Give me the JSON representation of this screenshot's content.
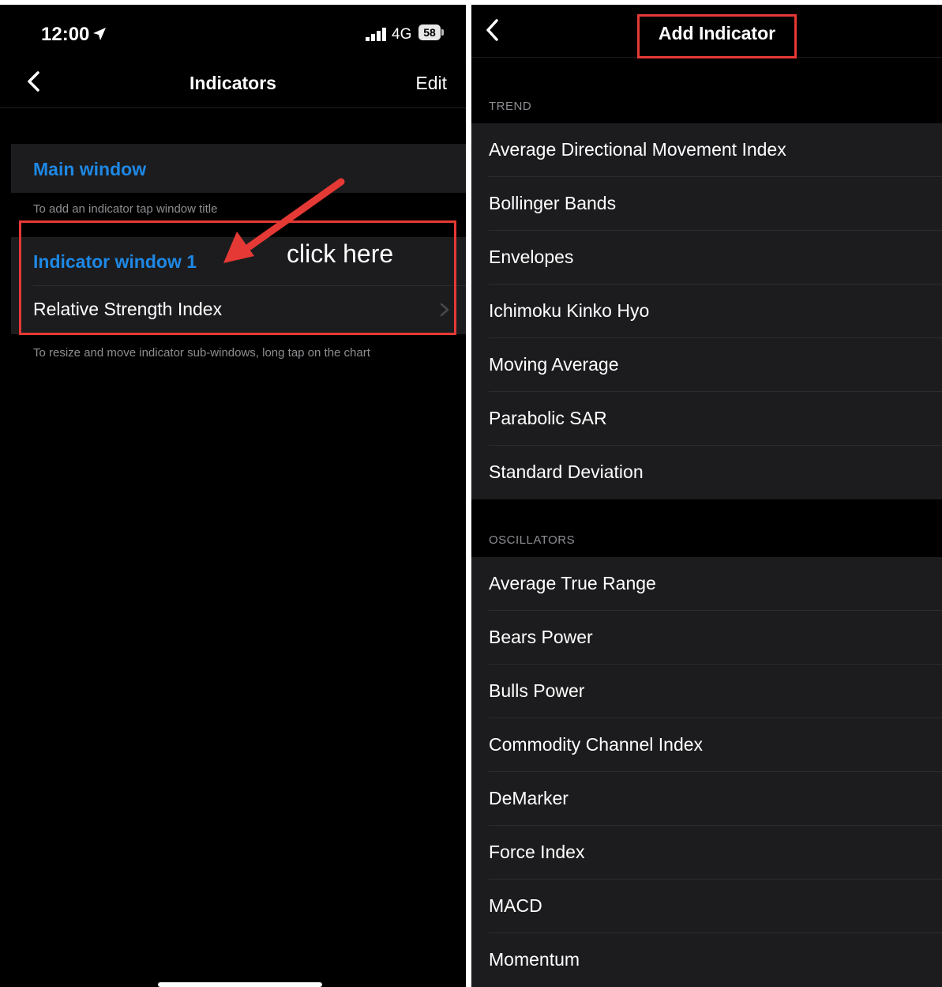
{
  "left": {
    "status": {
      "time": "12:00",
      "network": "4G",
      "battery": "58"
    },
    "nav": {
      "title": "Indicators",
      "edit_label": "Edit"
    },
    "main_window": {
      "title": "Main window"
    },
    "hint": "To add an indicator tap window title",
    "indicator_window": {
      "title": "Indicator window 1",
      "items": [
        "Relative Strength Index"
      ]
    },
    "footer_hint": "To resize and move indicator sub-windows, long tap on the chart",
    "annotation": {
      "text": "click here",
      "color": "#e53935"
    }
  },
  "right": {
    "nav": {
      "title": "Add Indicator"
    },
    "sections": [
      {
        "header": "TREND",
        "items": [
          "Average Directional Movement Index",
          "Bollinger Bands",
          "Envelopes",
          "Ichimoku Kinko Hyo",
          "Moving Average",
          "Parabolic SAR",
          "Standard Deviation"
        ]
      },
      {
        "header": "OSCILLATORS",
        "items": [
          "Average True Range",
          "Bears Power",
          "Bulls Power",
          "Commodity Channel Index",
          "DeMarker",
          "Force Index",
          "MACD",
          "Momentum"
        ]
      }
    ]
  },
  "colors": {
    "accent": "#1e88e5",
    "annotation": "#e53935",
    "background": "#000000",
    "cell": "#1c1c1e"
  },
  "icons": [
    "location-arrow-icon",
    "signal-bars-icon",
    "battery-icon",
    "back-chevron-icon",
    "chevron-right-icon"
  ]
}
